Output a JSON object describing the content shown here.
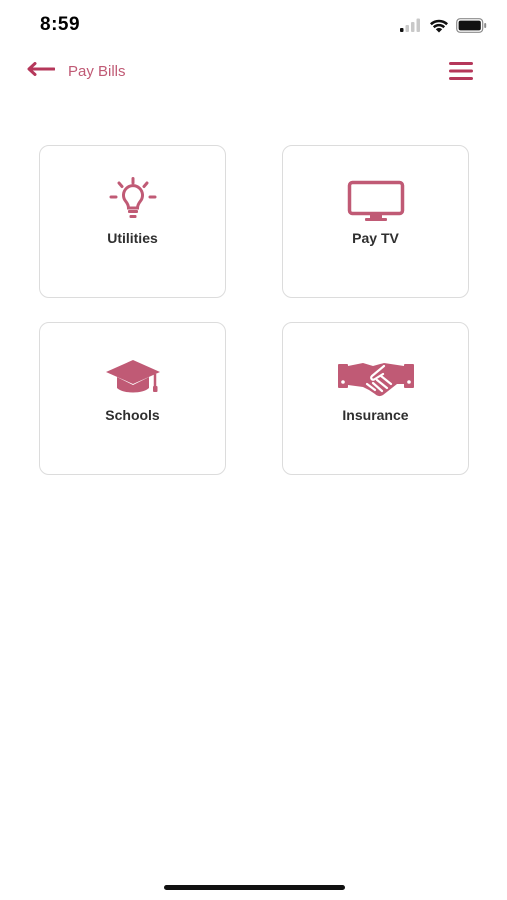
{
  "status_bar": {
    "time": "8:59",
    "signal_icon": "cellular-signal-icon",
    "wifi_icon": "wifi-icon",
    "battery_icon": "battery-icon"
  },
  "header": {
    "back_icon": "back-arrow-icon",
    "title": "Pay Bills",
    "menu_icon": "hamburger-menu-icon"
  },
  "categories": [
    {
      "label": "Utilities",
      "icon": "lightbulb-icon"
    },
    {
      "label": "Pay TV",
      "icon": "tv-icon"
    },
    {
      "label": "Schools",
      "icon": "graduation-cap-icon"
    },
    {
      "label": "Insurance",
      "icon": "handshake-icon"
    }
  ],
  "colors": {
    "accent": "#c05a75",
    "card_border": "#dcdcdc",
    "text": "#2f2f2f"
  }
}
